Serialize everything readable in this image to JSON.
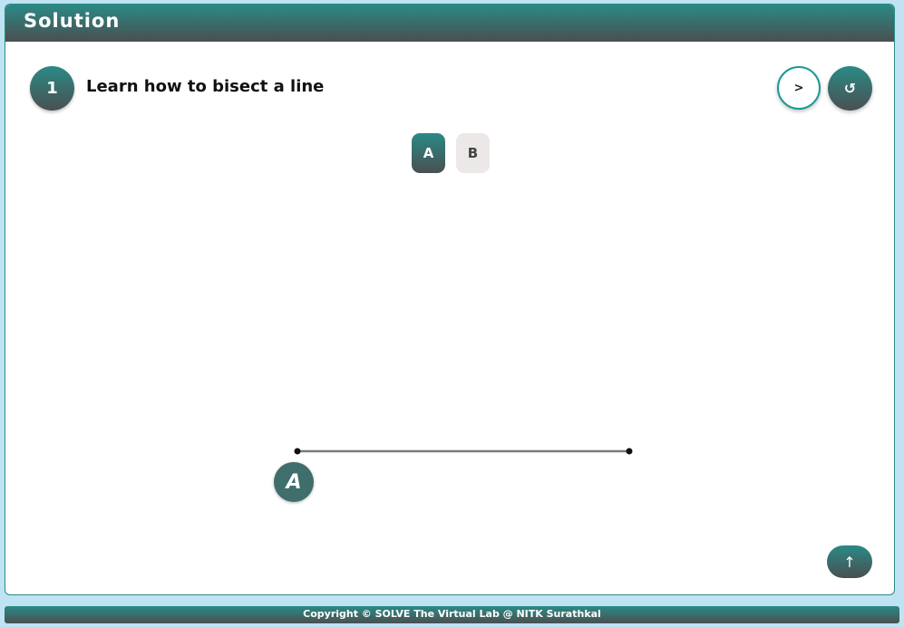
{
  "header": {
    "title": "Solution"
  },
  "step": {
    "number": "1",
    "title": "Learn how to bisect a line"
  },
  "controls": {
    "next_label": ">",
    "reset_icon": "reset-icon",
    "reset_label": "↺"
  },
  "tabs": [
    {
      "label": "A",
      "active": true
    },
    {
      "label": "B",
      "active": false
    }
  ],
  "diagram": {
    "point_label": "A"
  },
  "scroll_top": {
    "label": "↑",
    "icon": "arrow-up-icon"
  },
  "footer": {
    "copyright": "Copyright © SOLVE The Virtual Lab @ NITK Surathkal"
  },
  "colors": {
    "accent": "#2a8a86",
    "accent_dark": "#4a4f51",
    "tab_inactive": "#ece8e8",
    "panel_border": "#2b8a86"
  }
}
